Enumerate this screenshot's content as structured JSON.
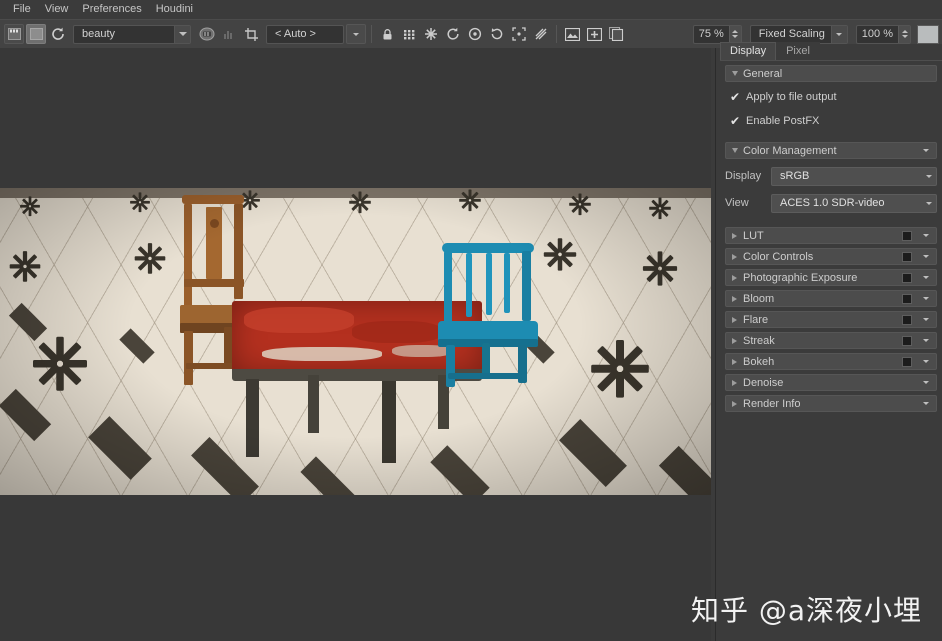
{
  "menubar": {
    "items": [
      {
        "label": "File"
      },
      {
        "label": "View"
      },
      {
        "label": "Preferences"
      },
      {
        "label": "Houdini"
      }
    ]
  },
  "toolbar": {
    "save_icon": "save-icon",
    "snapshot_icon": "snapshot-icon",
    "reload_icon": "reload-icon",
    "aov_value": "beauty",
    "aov_placeholder": "beauty",
    "camera_icon": "camera-icon",
    "histogram_icon": "histogram-icon",
    "crop_icon": "crop-icon",
    "region_value": "< Auto >",
    "icons": [
      {
        "name": "lock-icon"
      },
      {
        "name": "grid-icon"
      },
      {
        "name": "snowflake-icon"
      },
      {
        "name": "refresh-icon"
      },
      {
        "name": "target-icon"
      },
      {
        "name": "rotate-icon"
      },
      {
        "name": "expand-icon"
      },
      {
        "name": "diagonal-icon"
      },
      {
        "name": "image-icon"
      },
      {
        "name": "add-image-icon"
      },
      {
        "name": "copy-image-icon"
      }
    ],
    "zoom_value": "75 %",
    "scaling_value": "Fixed Scaling",
    "scaling_percent": "100 %"
  },
  "panel": {
    "tabs": [
      {
        "label": "Display",
        "active": true
      },
      {
        "label": "Pixel",
        "active": false
      }
    ],
    "general": {
      "title": "General",
      "checkboxes": [
        {
          "label": "Apply to file output",
          "checked": true
        },
        {
          "label": "Enable PostFX",
          "checked": true
        }
      ]
    },
    "color_management": {
      "title": "Color Management",
      "fields": [
        {
          "label": "Display",
          "value": "sRGB"
        },
        {
          "label": "View",
          "value": "ACES 1.0 SDR-video"
        }
      ]
    },
    "sections": [
      {
        "label": "LUT",
        "toggle": true
      },
      {
        "label": "Color Controls",
        "toggle": true
      },
      {
        "label": "Photographic Exposure",
        "toggle": true
      },
      {
        "label": "Bloom",
        "toggle": true
      },
      {
        "label": "Flare",
        "toggle": true
      },
      {
        "label": "Streak",
        "toggle": true
      },
      {
        "label": "Bokeh",
        "toggle": true
      },
      {
        "label": "Denoise",
        "toggle": false
      },
      {
        "label": "Render Info",
        "toggle": false
      }
    ]
  },
  "render": {
    "description": "Rendered interior scene: two chairs and a weathered red table on a patterned marble tile floor",
    "wood_chair_color": "#9a5f2c",
    "teal_chair_color": "#1d8cb2",
    "table_top_color": "#b4301f",
    "floor_color": "#e8e0d2"
  },
  "watermark": {
    "text": "知乎 @a深夜小埋"
  }
}
